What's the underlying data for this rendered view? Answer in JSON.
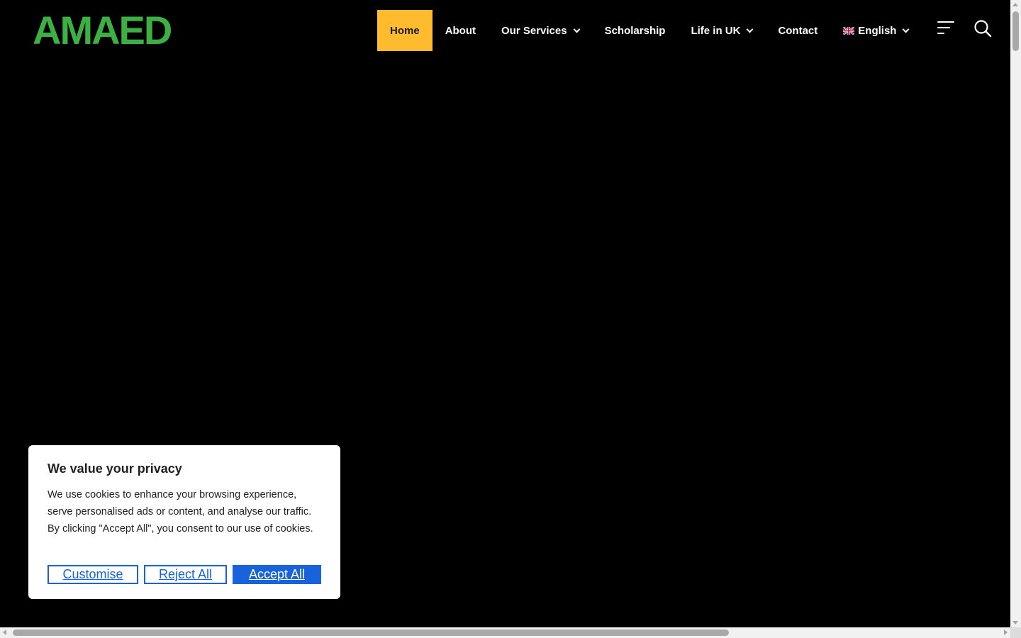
{
  "brand": {
    "logo_text": "AMAED",
    "color": "#3cb043"
  },
  "nav": {
    "items": [
      {
        "label": "Home",
        "active": true,
        "has_dropdown": false
      },
      {
        "label": "About",
        "active": false,
        "has_dropdown": false
      },
      {
        "label": "Our Services",
        "active": false,
        "has_dropdown": true
      },
      {
        "label": "Scholarship",
        "active": false,
        "has_dropdown": false
      },
      {
        "label": "Life in UK",
        "active": false,
        "has_dropdown": true
      },
      {
        "label": "Contact",
        "active": false,
        "has_dropdown": false
      },
      {
        "label": "English",
        "active": false,
        "has_dropdown": true,
        "icon": "uk-flag-icon"
      }
    ],
    "active_color": "#fdbb2d",
    "menu_icon": "menu-lines-icon",
    "search_icon": "search-icon"
  },
  "cookie_banner": {
    "title": "We value your privacy",
    "body": "We use cookies to enhance your browsing experience, serve personalised ads or content, and analyse our traffic. By clicking \"Accept All\", you consent to our use of cookies.",
    "customise_label": "Customise",
    "reject_label": "Reject All",
    "accept_label": "Accept All",
    "accent_color": "#1863dc"
  }
}
